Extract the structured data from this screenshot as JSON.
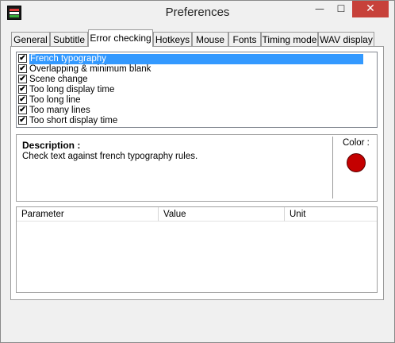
{
  "window": {
    "title": "Preferences",
    "buttons": {
      "minimize": "—",
      "maximize": "☐",
      "close": "✕"
    }
  },
  "tabs": [
    {
      "label": "General",
      "active": false
    },
    {
      "label": "Subtitle",
      "active": false
    },
    {
      "label": "Error checking",
      "active": true
    },
    {
      "label": "Hotkeys",
      "active": false
    },
    {
      "label": "Mouse",
      "active": false
    },
    {
      "label": "Fonts",
      "active": false
    },
    {
      "label": "Timing mode",
      "active": false
    },
    {
      "label": "WAV display",
      "active": false
    }
  ],
  "checks": [
    {
      "label": "French typography",
      "checked": true,
      "selected": true
    },
    {
      "label": "Overlapping & minimum blank",
      "checked": true,
      "selected": false
    },
    {
      "label": "Scene change",
      "checked": true,
      "selected": false
    },
    {
      "label": "Too long display time",
      "checked": true,
      "selected": false
    },
    {
      "label": "Too long line",
      "checked": true,
      "selected": false
    },
    {
      "label": "Too many lines",
      "checked": true,
      "selected": false
    },
    {
      "label": "Too short display time",
      "checked": true,
      "selected": false
    }
  ],
  "description": {
    "title": "Description :",
    "text": "Check text against french typography rules.",
    "color_label": "Color :",
    "color": "#c40000"
  },
  "params": {
    "headers": [
      "Parameter",
      "Value",
      "Unit"
    ]
  },
  "icons": {
    "app": "subtitle-workshop-app-icon",
    "check": "✔"
  },
  "colors": {
    "selection": "#3399ff",
    "close_button": "#c7413a"
  }
}
